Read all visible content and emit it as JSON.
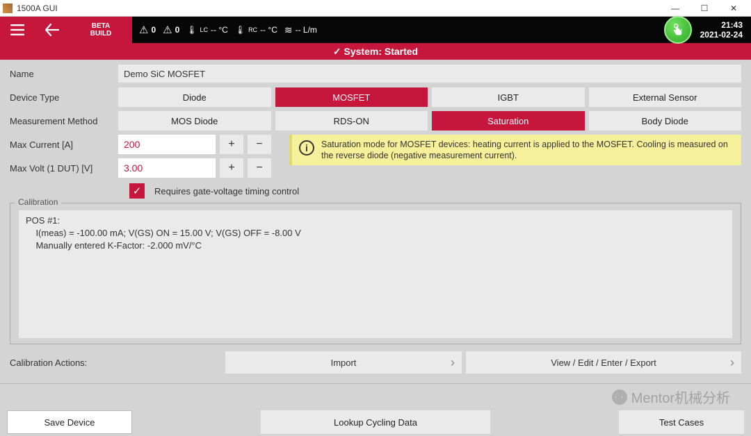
{
  "window": {
    "title": "1500A GUI"
  },
  "header": {
    "beta": "BETA\nBUILD",
    "warn1": "0",
    "warn2": "0",
    "temp_lc_label": "LC",
    "temp_lc_val": "-- °C",
    "temp_rc_label": "RC",
    "temp_rc_val": "-- °C",
    "flow_val": "-- L/m",
    "time": "21:43",
    "date": "2021-02-24"
  },
  "banner": "✓ System: Started",
  "form": {
    "name_label": "Name",
    "name_value": "Demo SiC MOSFET",
    "device_type_label": "Device Type",
    "device_types": [
      "Diode",
      "MOSFET",
      "IGBT",
      "External Sensor"
    ],
    "device_type_selected": "MOSFET",
    "method_label": "Measurement Method",
    "methods": [
      "MOS Diode",
      "RDS-ON",
      "Saturation",
      "Body Diode"
    ],
    "method_selected": "Saturation",
    "max_current_label": "Max Current [A]",
    "max_current_value": "200",
    "max_volt_label": "Max Volt (1 DUT) [V]",
    "max_volt_value": "3.00",
    "info_text": "Saturation mode for MOSFET devices: heating current is applied to the MOSFET. Cooling is measured on the reverse diode (negative measurement current).",
    "gate_check_label": "Requires gate-voltage timing control",
    "plus": "+",
    "minus": "−"
  },
  "calibration": {
    "legend": "Calibration",
    "text": "POS #1:\n    I(meas) = -100.00 mA; V(GS) ON = 15.00 V; V(GS) OFF = -8.00 V\n    Manually entered K-Factor: -2.000 mV/°C",
    "actions_label": "Calibration Actions:",
    "import_label": "Import",
    "view_label": "View / Edit / Enter / Export"
  },
  "bottom": {
    "save": "Save Device",
    "lookup": "Lookup Cycling Data",
    "testcases": "Test Cases"
  },
  "watermark": "Mentor机械分析"
}
